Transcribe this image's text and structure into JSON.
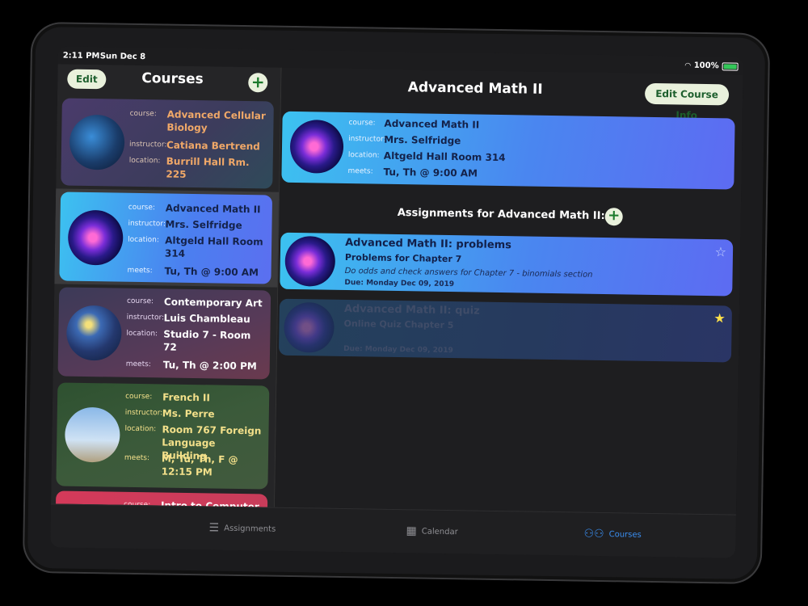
{
  "status": {
    "time": "2:11 PM",
    "date": "Sun Dec 8",
    "battery": "100%"
  },
  "sidebar": {
    "title": "Courses",
    "edit_label": "Edit",
    "add_label": "+",
    "courses": [
      {
        "course_label": "course:",
        "course": "Advanced Cellular Biology",
        "instructor_label": "instructor:",
        "instructor": "Catiana Bertrend",
        "location_label": "location:",
        "location": "Burrill Hall Rm. 225"
      },
      {
        "course_label": "course:",
        "course": "Advanced Math II",
        "instructor_label": "instructor:",
        "instructor": "Mrs. Selfridge",
        "location_label": "location:",
        "location": "Altgeld Hall Room 314",
        "meets_label": "meets:",
        "meets": "Tu, Th @ 9:00 AM"
      },
      {
        "course_label": "course:",
        "course": "Contemporary Art",
        "instructor_label": "instructor:",
        "instructor": "Luis Chambleau",
        "location_label": "location:",
        "location": "Studio 7 - Room 72",
        "meets_label": "meets:",
        "meets": "Tu, Th @ 2:00 PM"
      },
      {
        "course_label": "course:",
        "course": "French II",
        "instructor_label": "instructor:",
        "instructor": "Ms. Perre",
        "location_label": "location:",
        "location": "Room 767 Foreign Language Building",
        "meets_label": "meets:",
        "meets": "M, Tu, Th, F @ 12:15 PM"
      },
      {
        "course_label": "course:",
        "course": "Intro to Computer S..."
      }
    ]
  },
  "detail": {
    "title": "Advanced Math II",
    "edit_info_label": "Edit Course Info",
    "info": {
      "course_label": "course:",
      "course": "Advanced Math II",
      "instructor_label": "instructor:",
      "instructor": "Mrs. Selfridge",
      "location_label": "location:",
      "location": "Altgeld Hall Room 314",
      "meets_label": "meets:",
      "meets": "Tu, Th @ 9:00 AM"
    },
    "assignments_header": "Assignments for Advanced Math II:",
    "assignments": [
      {
        "title": "Advanced Math II: problems",
        "subtitle": "Problems for Chapter 7",
        "notes": "Do odds and check answers for Chapter 7 - binomials section",
        "due": "Due: Monday Dec 09, 2019",
        "starred": false,
        "star": "☆"
      },
      {
        "title": "Advanced Math II: quiz",
        "subtitle": "Online Quiz Chapter 5",
        "notes": "",
        "due": "Due: Monday Dec 09, 2019",
        "starred": true,
        "star": "★"
      }
    ]
  },
  "tabbar": {
    "tabs": [
      {
        "label": "Assignments",
        "icon": "list-icon"
      },
      {
        "label": "Calendar",
        "icon": "calendar-icon"
      },
      {
        "label": "Courses",
        "icon": "people-icon",
        "selected": true
      }
    ]
  },
  "colors": {
    "accent": "#3a8ef0",
    "pill_bg": "#e9f1dc",
    "pill_text": "#1c5e2c",
    "star_filled": "#ffe14a"
  }
}
